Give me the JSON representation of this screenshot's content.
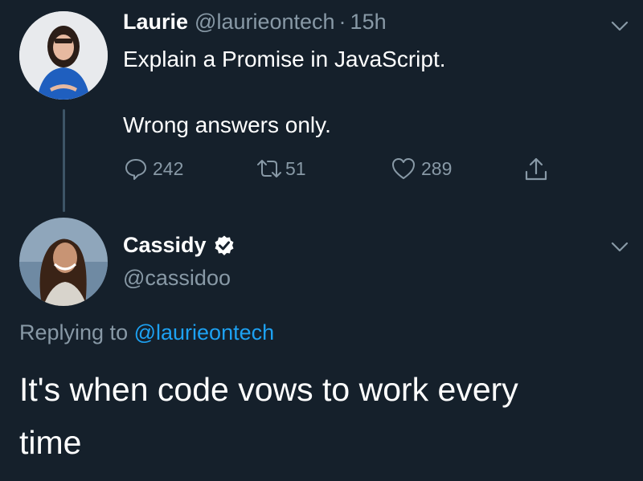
{
  "tweet1": {
    "name": "Laurie",
    "handle": "@laurieontech",
    "separator": "·",
    "time": "15h",
    "text_line1": "Explain a Promise in JavaScript.",
    "text_line2": "Wrong answers only.",
    "reply_count": "242",
    "retweet_count": "51",
    "like_count": "289"
  },
  "tweet2": {
    "name": "Cassidy",
    "handle": "@cassidoo",
    "replying_prefix": "Replying to",
    "replying_handle": "@laurieontech",
    "text_line1": "It's when code vows to work every",
    "text_line2": "time"
  },
  "colors": {
    "background": "#15202b",
    "muted": "#8899a6",
    "link": "#1da1f2",
    "verified_badge": "#ffffff"
  },
  "icons": [
    "chevron-down-icon",
    "reply-icon",
    "retweet-icon",
    "like-icon",
    "share-icon",
    "verified-icon"
  ]
}
